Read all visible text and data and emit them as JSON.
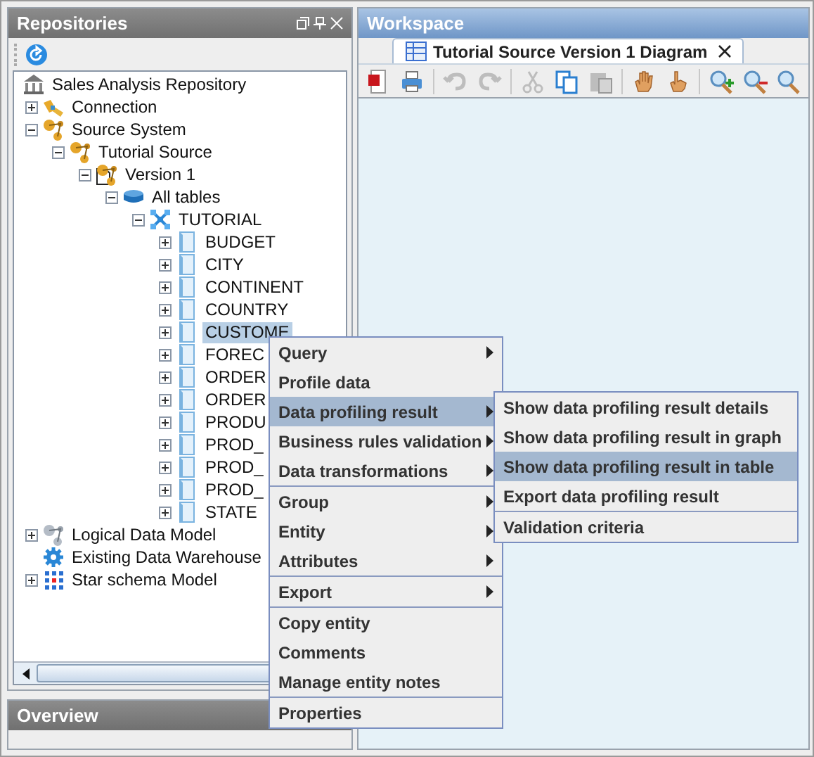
{
  "repositories": {
    "title": "Repositories",
    "tree": [
      {
        "label": "Sales Analysis Repository",
        "kind": "repository",
        "children": [
          {
            "label": "Connection",
            "kind": "connection",
            "expanded": false
          },
          {
            "label": "Source System",
            "kind": "source",
            "expanded": true,
            "children": [
              {
                "label": "Tutorial Source",
                "kind": "source",
                "expanded": true,
                "children": [
                  {
                    "label": "Version 1",
                    "kind": "version",
                    "expanded": true,
                    "children": [
                      {
                        "label": "All tables",
                        "kind": "tables",
                        "expanded": true,
                        "children": [
                          {
                            "label": "TUTORIAL",
                            "kind": "schema",
                            "expanded": true,
                            "children": [
                              {
                                "label": "BUDGET",
                                "kind": "table",
                                "expanded": false,
                                "selected": false
                              },
                              {
                                "label": "CITY",
                                "kind": "table",
                                "expanded": false,
                                "selected": false
                              },
                              {
                                "label": "CONTINENT",
                                "kind": "table",
                                "expanded": false,
                                "selected": false
                              },
                              {
                                "label": "COUNTRY",
                                "kind": "table",
                                "expanded": false,
                                "selected": false
                              },
                              {
                                "label": "CUSTOME",
                                "kind": "table",
                                "expanded": false,
                                "selected": true
                              },
                              {
                                "label": "FOREC",
                                "kind": "table",
                                "expanded": false,
                                "selected": false
                              },
                              {
                                "label": "ORDER",
                                "kind": "table",
                                "expanded": false,
                                "selected": false
                              },
                              {
                                "label": "ORDER",
                                "kind": "table",
                                "expanded": false,
                                "selected": false
                              },
                              {
                                "label": "PRODU",
                                "kind": "table",
                                "expanded": false,
                                "selected": false
                              },
                              {
                                "label": "PROD_",
                                "kind": "table",
                                "expanded": false,
                                "selected": false
                              },
                              {
                                "label": "PROD_",
                                "kind": "table",
                                "expanded": false,
                                "selected": false
                              },
                              {
                                "label": "PROD_",
                                "kind": "table",
                                "expanded": false,
                                "selected": false
                              },
                              {
                                "label": "STATE",
                                "kind": "table",
                                "expanded": false,
                                "selected": false
                              }
                            ]
                          }
                        ]
                      }
                    ]
                  }
                ]
              }
            ]
          },
          {
            "label": "Logical Data Model",
            "kind": "logical",
            "expanded": false
          },
          {
            "label": "Existing Data Warehouse",
            "kind": "warehouse"
          },
          {
            "label": "Star schema Model",
            "kind": "star",
            "expanded": false
          }
        ]
      }
    ]
  },
  "overview": {
    "title": "Overview"
  },
  "workspace": {
    "title": "Workspace",
    "tab": {
      "label": "Tutorial Source Version 1 Diagram",
      "selected": true
    },
    "toolbar": [
      {
        "kind": "pdf",
        "disabled": false
      },
      {
        "kind": "print",
        "disabled": false
      },
      {
        "kind": "sep"
      },
      {
        "kind": "undo",
        "disabled": true
      },
      {
        "kind": "redo",
        "disabled": true
      },
      {
        "kind": "sep"
      },
      {
        "kind": "cut",
        "disabled": true
      },
      {
        "kind": "copy",
        "disabled": false
      },
      {
        "kind": "paste",
        "disabled": true
      },
      {
        "kind": "sep"
      },
      {
        "kind": "hand",
        "disabled": false
      },
      {
        "kind": "pointer",
        "disabled": false
      },
      {
        "kind": "sep"
      },
      {
        "kind": "zoom-in",
        "disabled": false
      },
      {
        "kind": "zoom-out",
        "disabled": false
      },
      {
        "kind": "zoom",
        "disabled": false
      }
    ]
  },
  "context_menu": {
    "groups": [
      [
        {
          "label": "Query",
          "submenu": true,
          "selected": false
        },
        {
          "label": "Profile data",
          "submenu": false,
          "selected": false
        },
        {
          "label": "Data profiling result",
          "submenu": true,
          "selected": true
        },
        {
          "label": "Business rules validation",
          "submenu": true,
          "selected": false
        },
        {
          "label": "Data transformations",
          "submenu": true,
          "selected": false
        }
      ],
      [
        {
          "label": "Group",
          "submenu": true,
          "selected": false
        },
        {
          "label": "Entity",
          "submenu": true,
          "selected": false
        },
        {
          "label": "Attributes",
          "submenu": true,
          "selected": false
        }
      ],
      [
        {
          "label": "Export",
          "submenu": true,
          "selected": false
        }
      ],
      [
        {
          "label": "Copy entity",
          "submenu": false,
          "selected": false
        },
        {
          "label": "Comments",
          "submenu": false,
          "selected": false
        },
        {
          "label": "Manage entity notes",
          "submenu": false,
          "selected": false
        }
      ],
      [
        {
          "label": "Properties",
          "submenu": false,
          "selected": false
        }
      ]
    ]
  },
  "submenu": {
    "groups": [
      [
        {
          "label": "Show data profiling result details",
          "selected": false
        },
        {
          "label": "Show data profiling result in graph",
          "selected": false
        },
        {
          "label": "Show data profiling result in table",
          "selected": true
        },
        {
          "label": "Export data profiling result",
          "selected": false
        }
      ],
      [
        {
          "label": "Validation criteria",
          "selected": false
        }
      ]
    ]
  }
}
